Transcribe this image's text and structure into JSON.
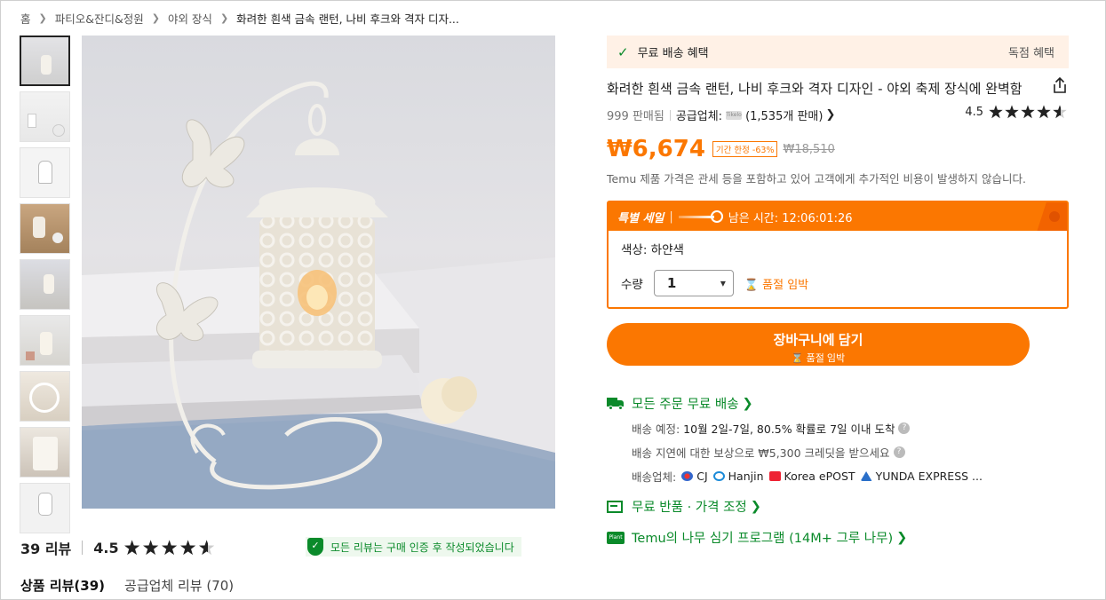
{
  "breadcrumb": [
    "홈",
    "파티오&잔디&정원",
    "야외 장식",
    "화려한 흰색 금속 랜턴, 나비 후크와 격자 디자..."
  ],
  "reviews": {
    "count_label": "39 리뷰",
    "rating": "4.5",
    "rating_value": 4.5,
    "verified_text": "모든 리뷰는 구매 인증 후 작성되었습니다",
    "tabs": [
      "상품 리뷰(39)",
      "공급업체 리뷰 (70)"
    ]
  },
  "banner": {
    "left": "무료 배송 혜택",
    "right": "독점 혜택"
  },
  "product": {
    "title": "화려한 흰색 금속 랜턴, 나비 후크와 격자 디자인 - 야외 축제 장식에 완벽함",
    "sold": "999 판매됨",
    "supplier_label": "공급업체:",
    "supplier_sales": "(1,535개 판매)",
    "rating": "4.5",
    "price": "₩6,674",
    "limited_badge": "기간 한정 -63%",
    "original_price": "₩18,510",
    "tax_note": "Temu 제품 가격은 관세 등을 포함하고 있어 고객에게 추가적인 비용이 발생하지 않습니다."
  },
  "sale": {
    "label": "특별 세일",
    "time_label": "남은 시간: 12:06:01:26",
    "color_label": "색상: 하얀색",
    "qty_label": "수량",
    "qty_value": "1",
    "low_stock": "품절 임박"
  },
  "cart": {
    "label": "장바구니에 담기",
    "sub": "품절 임박"
  },
  "shipping": {
    "head": "모든 주문 무료 배송",
    "eta_label": "배송 예정:",
    "eta_value": "10월 2일-7일, 80.5% 확률로 7일 이내 도착",
    "delay": "배송 지연에 대한 보상으로 ₩5,300 크레딧을 받으세요",
    "carriers_label": "배송업체:",
    "carriers": [
      "CJ",
      "Hanjin",
      "Korea ePOST",
      "YUNDA EXPRESS ..."
    ]
  },
  "returns": "무료 반품 · 가격 조정",
  "plant": "Temu의 나무 심기 프로그램 (14M+ 그루 나무)",
  "colors": {
    "accent": "#fb7701",
    "green": "#0a8a2a"
  }
}
